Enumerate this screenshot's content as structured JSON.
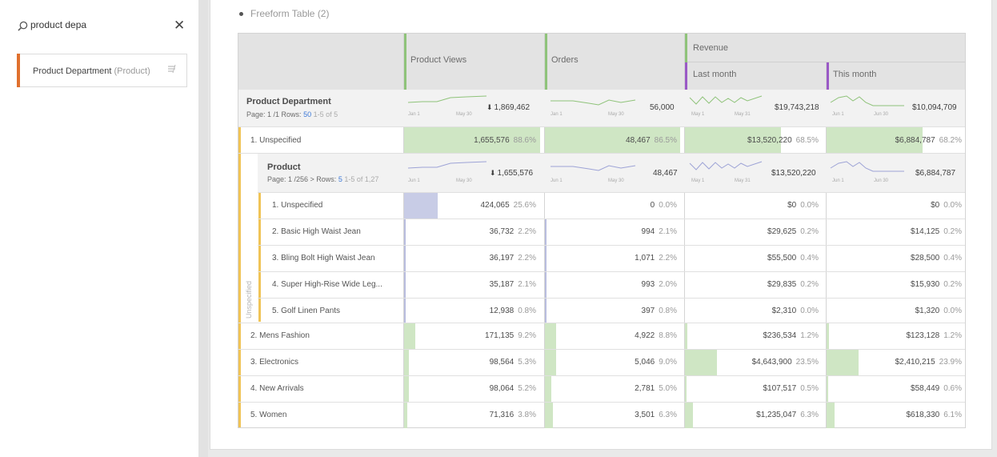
{
  "search": {
    "value": "product depa"
  },
  "component": {
    "name": "Product Department",
    "type": "(Product)"
  },
  "panel": {
    "title": "Freeform Table (2)"
  },
  "columns": {
    "product_views": "Product Views",
    "orders": "Orders",
    "revenue": "Revenue",
    "last_month": "Last month",
    "this_month": "This month"
  },
  "summary_dept": {
    "title": "Product Department",
    "page_prefix": "Page: 1 /1  Rows:",
    "rows": "50",
    "range": "1-5 of 5",
    "pv_total": "1,869,462",
    "orders_total": "56,000",
    "rev_last_total": "$19,743,218",
    "rev_this_total": "$10,094,709",
    "spark_pv": [
      "Jan 1",
      "May 30"
    ],
    "spark_orders": [
      "Jan 1",
      "May 30"
    ],
    "spark_last": [
      "May 1",
      "May 31"
    ],
    "spark_this": [
      "Jun 1",
      "Jun 30"
    ]
  },
  "dept_row_1": {
    "label": "1. Unspecified",
    "pv": "1,655,576",
    "pv_pct": "88.6%",
    "orders": "48,467",
    "orders_pct": "86.5%",
    "last": "$13,520,220",
    "last_pct": "68.5%",
    "this": "$6,884,787",
    "this_pct": "68.2%"
  },
  "summary_product": {
    "title": "Product",
    "page_prefix": "Page: 1 /256 >  Rows:",
    "rows": "5",
    "range": "1-5 of 1,27",
    "pv_total": "1,655,576",
    "orders_total": "48,467",
    "rev_last_total": "$13,520,220",
    "rev_this_total": "$6,884,787",
    "spark_pv": [
      "Jun 1",
      "May 30"
    ],
    "spark_orders": [
      "Jun 1",
      "May 30"
    ],
    "spark_last": [
      "May 1",
      "May 31"
    ],
    "spark_this": [
      "Jun 1",
      "Jun 30"
    ]
  },
  "breakdown_label": "Unspecified",
  "product_rows": [
    {
      "label": "1. Unspecified",
      "pv": "424,065",
      "pv_pct": "25.6%",
      "orders": "0",
      "orders_pct": "0.0%",
      "last": "$0",
      "last_pct": "0.0%",
      "this": "$0",
      "this_pct": "0.0%"
    },
    {
      "label": "2. Basic High Waist Jean",
      "pv": "36,732",
      "pv_pct": "2.2%",
      "orders": "994",
      "orders_pct": "2.1%",
      "last": "$29,625",
      "last_pct": "0.2%",
      "this": "$14,125",
      "this_pct": "0.2%"
    },
    {
      "label": "3. Bling Bolt High Waist Jean",
      "pv": "36,197",
      "pv_pct": "2.2%",
      "orders": "1,071",
      "orders_pct": "2.2%",
      "last": "$55,500",
      "last_pct": "0.4%",
      "this": "$28,500",
      "this_pct": "0.4%"
    },
    {
      "label": "4. Super High-Rise Wide Leg...",
      "pv": "35,187",
      "pv_pct": "2.1%",
      "orders": "993",
      "orders_pct": "2.0%",
      "last": "$29,835",
      "last_pct": "0.2%",
      "this": "$15,930",
      "this_pct": "0.2%"
    },
    {
      "label": "5. Golf Linen Pants",
      "pv": "12,938",
      "pv_pct": "0.8%",
      "orders": "397",
      "orders_pct": "0.8%",
      "last": "$2,310",
      "last_pct": "0.0%",
      "this": "$1,320",
      "this_pct": "0.0%"
    }
  ],
  "dept_rows": [
    {
      "label": "2. Mens Fashion",
      "pv": "171,135",
      "pv_pct": "9.2%",
      "orders": "4,922",
      "orders_pct": "8.8%",
      "last": "$236,534",
      "last_pct": "1.2%",
      "this": "$123,128",
      "this_pct": "1.2%"
    },
    {
      "label": "3. Electronics",
      "pv": "98,564",
      "pv_pct": "5.3%",
      "orders": "5,046",
      "orders_pct": "9.0%",
      "last": "$4,643,900",
      "last_pct": "23.5%",
      "this": "$2,410,215",
      "this_pct": "23.9%"
    },
    {
      "label": "4. New Arrivals",
      "pv": "98,064",
      "pv_pct": "5.2%",
      "orders": "2,781",
      "orders_pct": "5.0%",
      "last": "$107,517",
      "last_pct": "0.5%",
      "this": "$58,449",
      "this_pct": "0.6%"
    },
    {
      "label": "5. Women",
      "pv": "71,316",
      "pv_pct": "3.8%",
      "orders": "3,501",
      "orders_pct": "6.3%",
      "last": "$1,235,047",
      "last_pct": "6.3%",
      "this": "$618,330",
      "this_pct": "6.1%"
    }
  ],
  "colors": {
    "accent_orange": "#e0702e",
    "bar_green": "#cfe6c4",
    "bar_purple": "#c8cce6",
    "stripe_yellow": "#f0c457",
    "header_green": "#8fc37a",
    "header_purple": "#9a59c6"
  }
}
